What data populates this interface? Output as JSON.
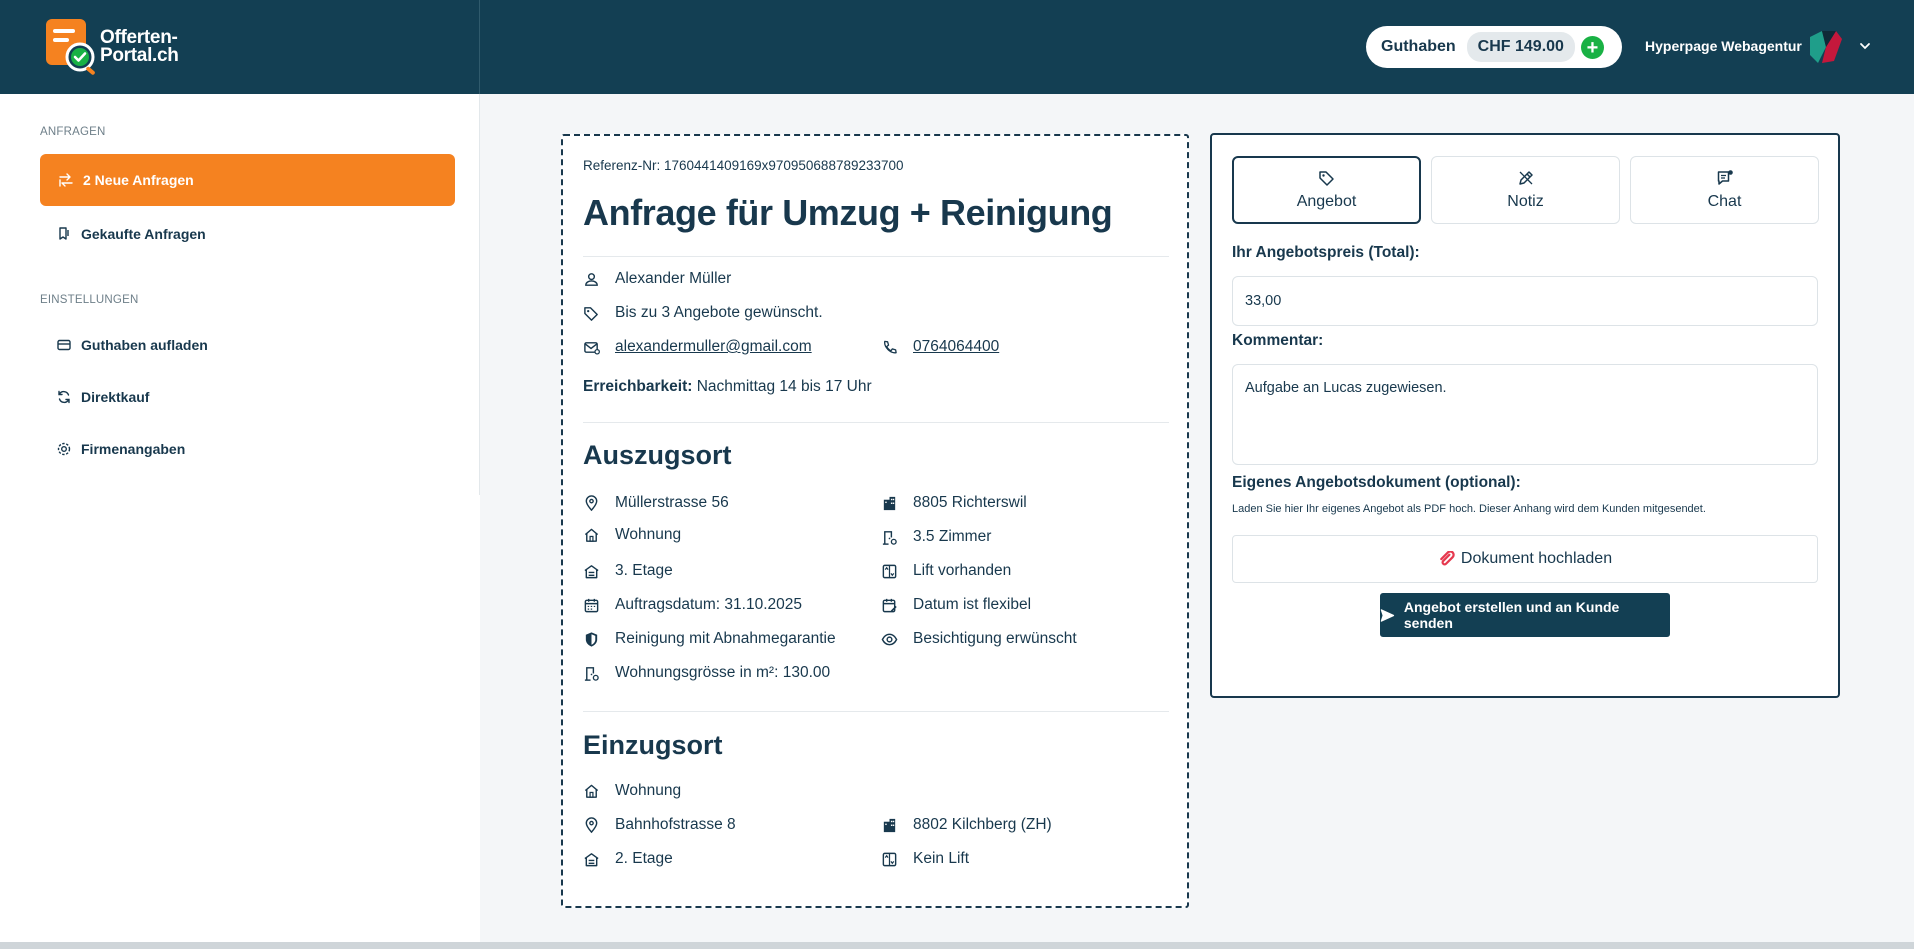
{
  "header": {
    "logo_line1": "Offerten-",
    "logo_line2": "Portal.ch",
    "balance_label": "Guthaben",
    "balance_amount": "CHF 149.00",
    "add_symbol": "+",
    "company_name": "Hyperpage Webagentur"
  },
  "sidebar": {
    "section_requests": "ANFRAGEN",
    "section_settings": "EINSTELLUNGEN",
    "items": [
      {
        "label": "2 Neue Anfragen",
        "icon": "inbox-arrow-icon"
      },
      {
        "label": "Gekaufte Anfragen",
        "icon": "bookmark-icon"
      },
      {
        "label": "Guthaben aufladen",
        "icon": "credit-card-icon"
      },
      {
        "label": "Direktkauf",
        "icon": "refresh-icon"
      },
      {
        "label": "Firmenangaben",
        "icon": "gear-icon"
      }
    ]
  },
  "request": {
    "reference": "Referenz-Nr: 1760441409169x970950688789233700",
    "title": "Anfrage für Umzug + Reinigung",
    "customer_name": "Alexander Müller",
    "offers_wanted": "Bis zu 3 Angebote gewünscht.",
    "email": "alexandermuller@gmail.com",
    "phone": "0764064400",
    "availability_label": "Erreichbarkeit:",
    "availability_value": "Nachmittag 14 bis 17 Uhr",
    "moveout": {
      "title": "Auszugsort",
      "street": "Müllerstrasse 56",
      "city": "8805 Richterswil",
      "type": "Wohnung",
      "rooms": "3.5 Zimmer",
      "floor": "3. Etage",
      "lift": "Lift vorhanden",
      "date": "Auftragsdatum: 31.10.2025",
      "date_flexible": "Datum ist flexibel",
      "cleaning": "Reinigung mit Abnahmegarantie",
      "viewing": "Besichtigung erwünscht",
      "size": "Wohnungsgrösse in m²: 130.00"
    },
    "movein": {
      "title": "Einzugsort",
      "type": "Wohnung",
      "street": "Bahnhofstrasse 8",
      "city": "8802 Kilchberg (ZH)",
      "floor": "2. Etage",
      "lift": "Kein Lift"
    }
  },
  "offer": {
    "tabs": [
      {
        "label": "Angebot",
        "icon": "tag-icon"
      },
      {
        "label": "Notiz",
        "icon": "pencil-icon"
      },
      {
        "label": "Chat",
        "icon": "chat-icon"
      }
    ],
    "price_label": "Ihr Angebotspreis (Total):",
    "price_value": "33,00",
    "comment_label": "Kommentar:",
    "comment_value": "Aufgabe an Lucas zugewiesen.",
    "document_label": "Eigenes Angebotsdokument (optional):",
    "document_hint": "Laden Sie hier Ihr eigenes Angebot als PDF hoch. Dieser Anhang wird dem Kunden mitgesendet.",
    "upload_label": "Dokument hochladen",
    "submit_label": "Angebot erstellen und an Kunde senden"
  },
  "colors": {
    "header_bg": "#133f53",
    "accent": "#f58220",
    "text": "#18384d",
    "success": "#19b144"
  }
}
